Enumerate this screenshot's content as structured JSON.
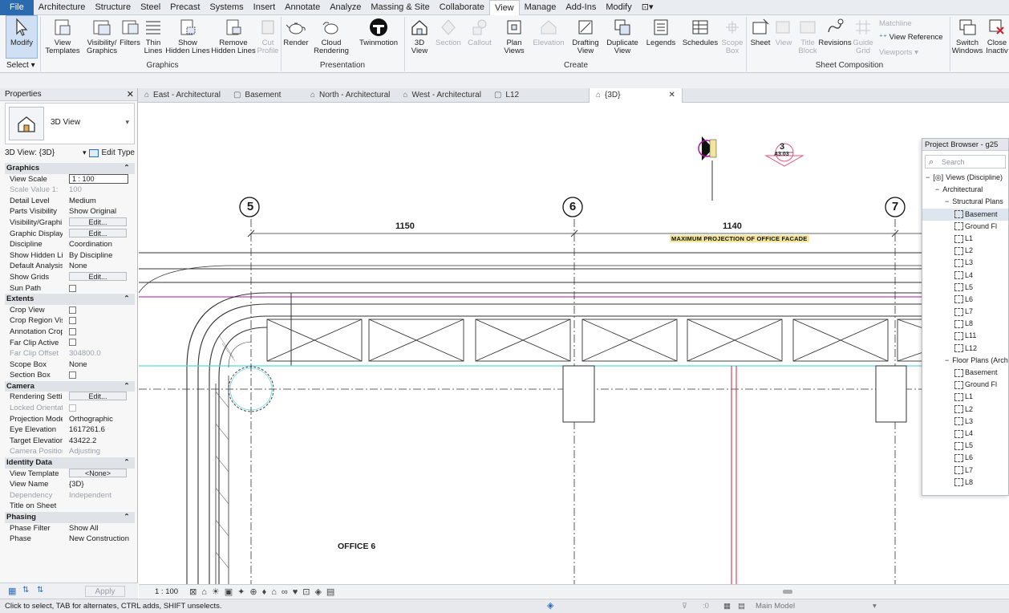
{
  "menu": {
    "items": [
      "File",
      "Architecture",
      "Structure",
      "Steel",
      "Precast",
      "Systems",
      "Insert",
      "Annotate",
      "Analyze",
      "Massing & Site",
      "Collaborate",
      "View",
      "Manage",
      "Add-Ins",
      "Modify",
      "⊡▾"
    ],
    "active": "View"
  },
  "ribbon": {
    "modify": "Modify",
    "select": "Select ▾",
    "view_templates": "View\nTemplates",
    "visibility_graphics": "Visibility/\nGraphics",
    "filters": "Filters",
    "thin_lines": "Thin\nLines",
    "show_hidden_lines": "Show\nHidden Lines",
    "remove_hidden_lines": "Remove\nHidden Lines",
    "cut_profile": "Cut\nProfile",
    "render": "Render",
    "cloud_rendering": "Cloud\nRendering",
    "twinmotion": "Twinmotion",
    "view_3d": "3D\nView",
    "section": "Section",
    "callout": "Callout",
    "plan_views": "Plan\nViews",
    "elevation": "Elevation",
    "drafting_view": "Drafting\nView",
    "duplicate_view": "Duplicate\nView",
    "legends": "Legends",
    "schedules": "Schedules",
    "scope_box": "Scope\nBox",
    "sheet": "Sheet",
    "view": "View",
    "title_block": "Title\nBlock",
    "revisions": "Revisions",
    "guide_grid": "Guide\nGrid",
    "matchline": "Matchline",
    "view_reference": "View Reference",
    "viewports": "Viewports ▾",
    "switch_windows": "Switch\nWindows",
    "close_inactive": "Close\nInactiv",
    "panels": {
      "graphics": "Graphics",
      "presentation": "Presentation",
      "create": "Create",
      "sheet_composition": "Sheet Composition"
    }
  },
  "tabs": [
    {
      "label": "East - Architectural",
      "icon": "elevation-icon"
    },
    {
      "label": "Basement",
      "icon": "plan-icon"
    },
    {
      "label": "North - Architectural",
      "icon": "elevation-icon"
    },
    {
      "label": "West - Architectural",
      "icon": "elevation-icon"
    },
    {
      "label": "L12",
      "icon": "plan-icon"
    },
    {
      "label": "{3D}",
      "icon": "house-icon",
      "active": true
    }
  ],
  "properties": {
    "title": "Properties",
    "type_name": "3D View",
    "view_selector": "3D View: {3D}",
    "edit_type": "Edit Type",
    "sections": [
      {
        "name": "Graphics",
        "rows": [
          {
            "k": "View Scale",
            "v": "1 : 100",
            "kind": "input"
          },
          {
            "k": "Scale Value  1:",
            "v": "100",
            "dis": true
          },
          {
            "k": "Detail Level",
            "v": "Medium"
          },
          {
            "k": "Parts Visibility",
            "v": "Show Original"
          },
          {
            "k": "Visibility/Graphi...",
            "v": "Edit...",
            "kind": "btn"
          },
          {
            "k": "Graphic Display...",
            "v": "Edit...",
            "kind": "btn"
          },
          {
            "k": "Discipline",
            "v": "Coordination"
          },
          {
            "k": "Show Hidden Li...",
            "v": "By Discipline"
          },
          {
            "k": "Default Analysis...",
            "v": "None"
          },
          {
            "k": "Show Grids",
            "v": "Edit...",
            "kind": "btn"
          },
          {
            "k": "Sun Path",
            "v": "",
            "kind": "chk"
          }
        ]
      },
      {
        "name": "Extents",
        "rows": [
          {
            "k": "Crop View",
            "v": "",
            "kind": "chk"
          },
          {
            "k": "Crop Region Vis...",
            "v": "",
            "kind": "chk"
          },
          {
            "k": "Annotation Crop",
            "v": "",
            "kind": "chk"
          },
          {
            "k": "Far Clip Active",
            "v": "",
            "kind": "chk"
          },
          {
            "k": "Far Clip Offset",
            "v": "304800.0",
            "dis": true
          },
          {
            "k": "Scope Box",
            "v": "None"
          },
          {
            "k": "Section Box",
            "v": "",
            "kind": "chk"
          }
        ]
      },
      {
        "name": "Camera",
        "rows": [
          {
            "k": "Rendering Setti...",
            "v": "Edit...",
            "kind": "btn"
          },
          {
            "k": "Locked Orientat...",
            "v": "",
            "kind": "chk",
            "dis": true
          },
          {
            "k": "Projection Mode",
            "v": "Orthographic"
          },
          {
            "k": "Eye Elevation",
            "v": "1617261.6"
          },
          {
            "k": "Target Elevation",
            "v": "43422.2"
          },
          {
            "k": "Camera Position",
            "v": "Adjusting",
            "dis": true
          }
        ]
      },
      {
        "name": "Identity Data",
        "rows": [
          {
            "k": "View Template",
            "v": "<None>",
            "kind": "btn"
          },
          {
            "k": "View Name",
            "v": "{3D}"
          },
          {
            "k": "Dependency",
            "v": "Independent",
            "dis": true
          },
          {
            "k": "Title on Sheet",
            "v": ""
          }
        ]
      },
      {
        "name": "Phasing",
        "rows": [
          {
            "k": "Phase Filter",
            "v": "Show All"
          },
          {
            "k": "Phase",
            "v": "New Construction"
          }
        ]
      }
    ],
    "apply": "Apply"
  },
  "canvas": {
    "grids": [
      "5",
      "6",
      "7"
    ],
    "dims": [
      "1150",
      "1140"
    ],
    "note": "MAXIMUM PROJECTION OF OFFICE FACADE",
    "section_tag_number": "3",
    "section_tag_sheet": "A3.03",
    "room_label": "OFFICE 6",
    "colors": {
      "magenta": "#b0149e",
      "cyan": "#5fd6e0",
      "red": "#d41c3c",
      "grid": "#333333"
    }
  },
  "browser": {
    "title": "Project Browser - g25",
    "search_placeholder": "Search",
    "tree": [
      {
        "label": "Views (Discipline)",
        "level": 0,
        "toggle": "−",
        "icon": "views"
      },
      {
        "label": "Architectural",
        "level": 1,
        "toggle": "−"
      },
      {
        "label": "Structural Plans",
        "level": 2,
        "toggle": "−"
      },
      {
        "label": "Basement",
        "level": 3,
        "sel": true
      },
      {
        "label": "Ground Fl",
        "level": 3
      },
      {
        "label": "L1",
        "level": 3
      },
      {
        "label": "L2",
        "level": 3
      },
      {
        "label": "L3",
        "level": 3
      },
      {
        "label": "L4",
        "level": 3
      },
      {
        "label": "L5",
        "level": 3
      },
      {
        "label": "L6",
        "level": 3
      },
      {
        "label": "L7",
        "level": 3
      },
      {
        "label": "L8",
        "level": 3
      },
      {
        "label": "L11",
        "level": 3
      },
      {
        "label": "L12",
        "level": 3
      },
      {
        "label": "Floor Plans (Arch",
        "level": 2,
        "toggle": "−"
      },
      {
        "label": "Basement",
        "level": 3
      },
      {
        "label": "Ground Fl",
        "level": 3
      },
      {
        "label": "L1",
        "level": 3
      },
      {
        "label": "L2",
        "level": 3
      },
      {
        "label": "L3",
        "level": 3
      },
      {
        "label": "L4",
        "level": 3
      },
      {
        "label": "L5",
        "level": 3
      },
      {
        "label": "L6",
        "level": 3
      },
      {
        "label": "L7",
        "level": 3
      },
      {
        "label": "L8",
        "level": 3
      }
    ]
  },
  "viewbar": {
    "scale": "1 : 100"
  },
  "status": {
    "hint": "Click to select, TAB for alternates, CTRL adds, SHIFT unselects.",
    "filter_count": ":0",
    "model": "Main Model"
  }
}
